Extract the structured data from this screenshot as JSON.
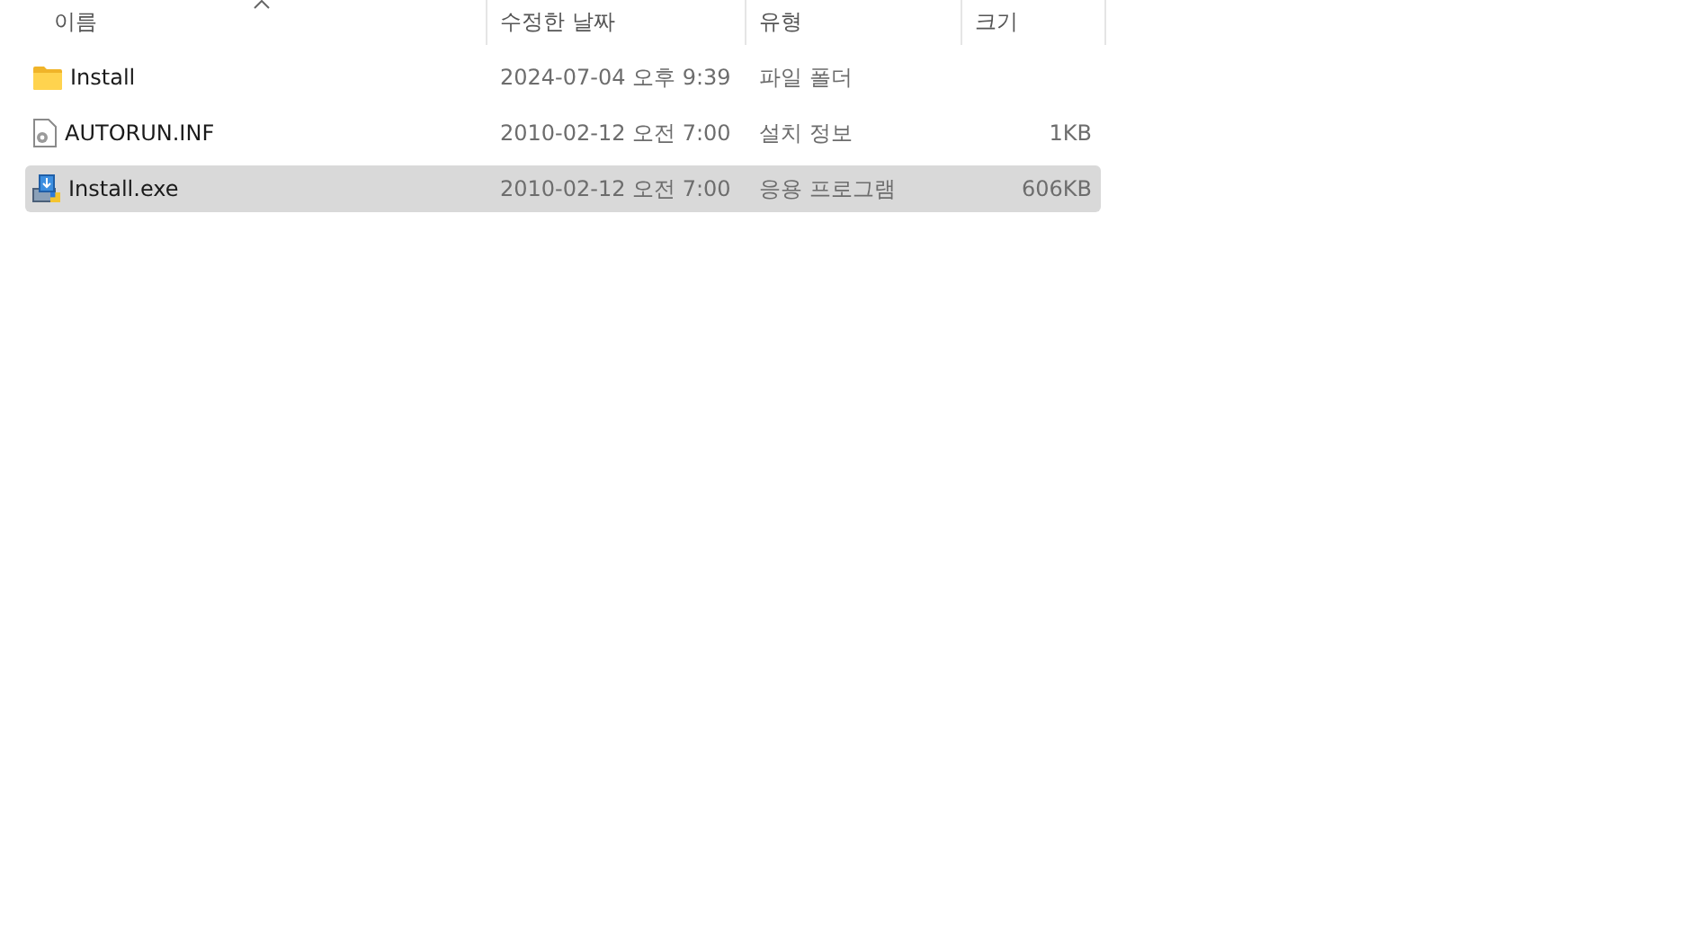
{
  "columns": [
    {
      "label": "이름",
      "sorted": true,
      "kind": "name"
    },
    {
      "label": "수정한 날짜",
      "sorted": false,
      "kind": "date"
    },
    {
      "label": "유형",
      "sorted": false,
      "kind": "type"
    },
    {
      "label": "크기",
      "sorted": false,
      "kind": "size"
    }
  ],
  "rows": [
    {
      "kind": "folder",
      "name": "Install",
      "date": "2024-07-04 오후 9:39",
      "type": "파일 폴더",
      "selected": false
    },
    {
      "kind": "settings",
      "name": "AUTORUN.INF",
      "date": "2010-02-12 오전 7:00",
      "type": "설치 정보",
      "size": "1KB",
      "selected": false
    },
    {
      "kind": "installer",
      "name": "Install.exe",
      "date": "2010-02-12 오전 7:00",
      "type": "응용 프로그램",
      "size": "606KB",
      "selected": true
    }
  ]
}
